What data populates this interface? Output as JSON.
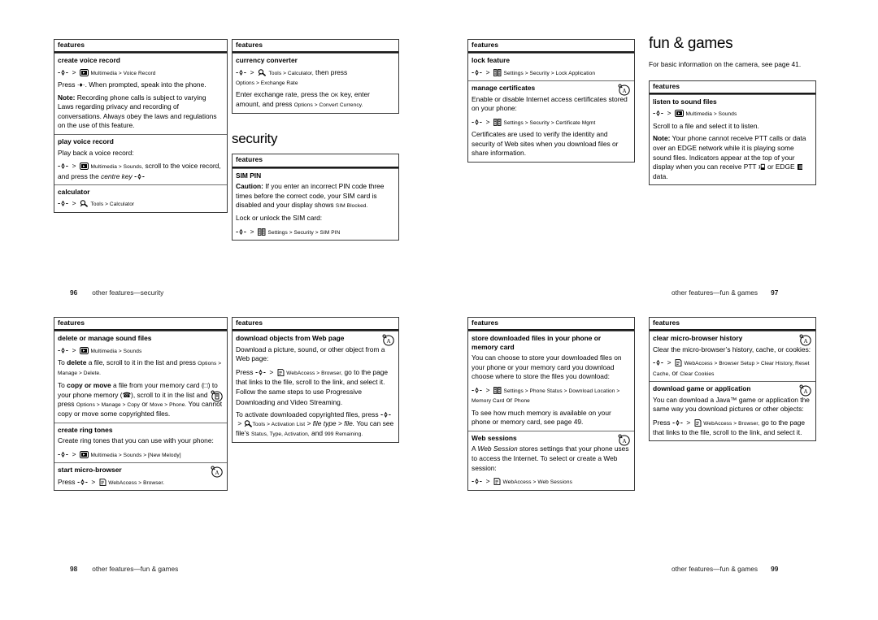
{
  "document": {
    "type": "phone-user-guide-spread",
    "pages": [
      "96",
      "97",
      "98",
      "99"
    ]
  },
  "footers": {
    "p96": {
      "number": "96",
      "label": "other features—security"
    },
    "p97": {
      "number": "97",
      "label": "other features—fun & games"
    },
    "p98": {
      "number": "98",
      "label": "other features—fun & games"
    },
    "p99": {
      "number": "99",
      "label": "other features—fun & games"
    }
  },
  "headings": {
    "security": "security",
    "fun_and_games": "fun & games",
    "fun_and_games_lead": "For basic information on the camera, see page 41."
  },
  "table_header": "features",
  "page96": {
    "box1": {
      "header": "features",
      "rows": [
        {
          "title": "create voice record",
          "nav1_pre": "",
          "nav1": "Multimedia > Voice Record",
          "p1": "Press ·♦·. When prompted, speak into the phone.",
          "note_label": "Note:",
          "note": " Recording phone calls is subject to varying Laws regarding privacy and recording of conversations. Always obey the laws and regulations on the use of this feature."
        },
        {
          "title": "play voice record",
          "p1": "Play back a voice record:",
          "nav1": "Multimedia > Sounds,",
          "nav1_tail": " scroll to the voice record, and press the ",
          "nav1_italic": "centre key"
        },
        {
          "title": "calculator",
          "nav1": "Tools > Calculator"
        }
      ]
    }
  },
  "page97_left": {
    "box1": {
      "header": "features",
      "rows": [
        {
          "title": "currency converter",
          "nav1": "Tools > Calculator,",
          "nav1_mid": " then press ",
          "nav1_tail": "Options > Exchange Rate",
          "p1_a": "Enter exchange rate, press the ",
          "p1_ok": "OK",
          "p1_b": " key, enter amount, and press ",
          "p1_c": "Options > Convert Currency."
        }
      ]
    },
    "box2": {
      "header": "features",
      "rows": [
        {
          "title": "SIM PIN",
          "caution_label": "Caution:",
          "caution": " If you enter an incorrect PIN code three times before the correct code, your SIM card is disabled and your display shows ",
          "caution_sm": "SIM Blocked.",
          "p2": "Lock or unlock the SIM card:",
          "nav1": "Settings > Security > SIM PIN"
        }
      ]
    }
  },
  "page97_mid": {
    "box1": {
      "header": "features",
      "rows": [
        {
          "title": "lock feature",
          "nav1": "Settings > Security > Lock Application"
        },
        {
          "title": "manage certificates",
          "badge": "browser-badge-icon",
          "p1": "Enable or disable Internet access certificates stored on your phone:",
          "nav1": "Settings > Security > Certificate Mgmt",
          "p2": "Certificates are used to verify the identity and security of Web sites when you download files or share information."
        }
      ]
    }
  },
  "page97_right": {
    "box1": {
      "header": "features",
      "rows": [
        {
          "title": "listen to sound files",
          "nav1": "Multimedia > Sounds",
          "p1": "Scroll to a file and select it to listen.",
          "note_label": "Note:",
          "note_a": " Your phone cannot receive PTT calls or data over an EDGE network while it is playing some sound files. Indicators appear at the top of your display when you can receive PTT ",
          "note_b": " or EDGE ",
          "note_c": " data."
        }
      ]
    }
  },
  "page98_left": {
    "box1": {
      "header": "features",
      "rows": [
        {
          "title": "delete or manage sound files",
          "nav1": "Multimedia > Sounds",
          "p1_a": "To ",
          "p1_b": "delete",
          "p1_c": " a file, scroll to it in the list and press ",
          "p1_sm": "Options > Manage > Delete.",
          "badge": "memory-card-badge-icon",
          "p2_a": "To ",
          "p2_b": "copy or move",
          "p2_c": " a file from your memory card (□) to your phone memory (☎), scroll to it in the list and press ",
          "p2_sm": "Options > Manage > Copy",
          "p2_or": " or ",
          "p2_sm2": "Move > Phone.",
          "p2_d": " You cannot copy or move some copyrighted files."
        },
        {
          "title": "create ring tones",
          "p1": "Create ring tones that you can use with your phone:",
          "nav1": "Multimedia > Sounds > [New Melody]"
        },
        {
          "title": "start micro-browser",
          "badge": "browser-badge-icon",
          "nav1_pre": "Press ",
          "nav1": "WebAccess > Browser."
        }
      ]
    }
  },
  "page98_right": {
    "box1": {
      "header": "features",
      "rows": [
        {
          "title": "download objects from Web page",
          "badge": "browser-badge-icon",
          "p1": "Download a picture, sound, or other object from a Web page:",
          "nav1_pre": "Press ",
          "nav1": "WebAccess > Browser,",
          "nav1_tail": " go to the page that links to the file, scroll to the link, and select it. Follow the same steps to use Progressive Downloading and Video Streaming.",
          "p2": "To activate downloaded copyrighted files, press ",
          "nav2": "Tools > Activation List",
          "nav2_b": "> file type > file.",
          "nav2_c": " You can see file’s ",
          "nav2_sm": "Status, Type, Activation,",
          "nav2_d": " and ",
          "nav2_sm2": "999 Remaining."
        }
      ]
    }
  },
  "page99_left": {
    "box1": {
      "header": "features",
      "rows": [
        {
          "title": "store downloaded files in your phone or memory card",
          "p1": "You can choose to store your downloaded files on your phone or your memory card you download choose where to store the files you download:",
          "nav1": "Settings > Phone Status > Download Location > Memory Card",
          "nav1_or": " or ",
          "nav1_tail": "Phone",
          "p2": "To see how much memory is available on your phone or memory card, see page 49."
        },
        {
          "title": "Web sessions",
          "badge": "browser-badge-icon",
          "p1_a": "A ",
          "p1_it": "Web Session",
          "p1_b": " stores settings that your phone uses to access the Internet. To select or create a Web session:",
          "nav1": "WebAccess > Web Sessions"
        }
      ]
    }
  },
  "page99_right": {
    "box1": {
      "header": "features",
      "rows": [
        {
          "title": "clear micro-browser history",
          "badge": "browser-badge-icon",
          "p1": "Clear the micro-browser’s history, cache, or cookies:",
          "nav1": "WebAccess > Browser Setup > Clear History, Reset Cache,",
          "nav1_or": " or ",
          "nav1_tail": "Clear Cookies"
        },
        {
          "title": "download game or application",
          "badge": "browser-badge-icon",
          "p1": "You can download a Java™ game or application the same way you download pictures or other objects:",
          "nav1_pre": "Press ",
          "nav1": "WebAccess > Browser,",
          "nav1_tail": " go to the page that links to the file, scroll to the link, and select it."
        }
      ]
    }
  },
  "icons": {
    "centre_key": "centre-key-icon",
    "multimedia": "multimedia-menu-icon",
    "tools": "tools-menu-icon",
    "settings": "settings-menu-icon",
    "webaccess": "webaccess-menu-icon",
    "browser_badge": "browser-badge-icon",
    "memory_badge": "memory-card-badge-icon",
    "ptt_indicator": "ptt-indicator-icon",
    "edge_indicator": "edge-indicator-icon"
  }
}
